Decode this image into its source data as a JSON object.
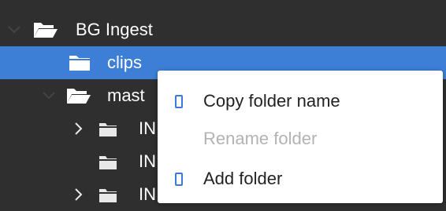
{
  "tree": {
    "nodes": [
      {
        "label": "BG Ingest",
        "expanded": true,
        "icon": "open-folder-icon"
      },
      {
        "label": "clips",
        "selected": true,
        "icon": "closed-folder-icon"
      },
      {
        "label": "mast",
        "expanded": true,
        "icon": "open-folder-icon"
      },
      {
        "label": "IN",
        "expanded": false,
        "icon": "closed-folder-icon"
      },
      {
        "label": "IN",
        "icon": "closed-folder-icon"
      },
      {
        "label": "IN",
        "expanded": false,
        "icon": "closed-folder-icon"
      }
    ]
  },
  "context_menu": {
    "items": [
      {
        "label": "Copy folder name",
        "enabled": true,
        "icon": "document-icon"
      },
      {
        "label": "Rename folder",
        "enabled": false
      },
      {
        "label": "Add folder",
        "enabled": true,
        "icon": "document-icon"
      }
    ]
  },
  "colors": {
    "background": "#2f2f2f",
    "selection": "#3d7fd6",
    "menu_background": "#ffffff",
    "menu_icon": "#3b7ad8",
    "disabled_text": "#b3b3b3"
  }
}
